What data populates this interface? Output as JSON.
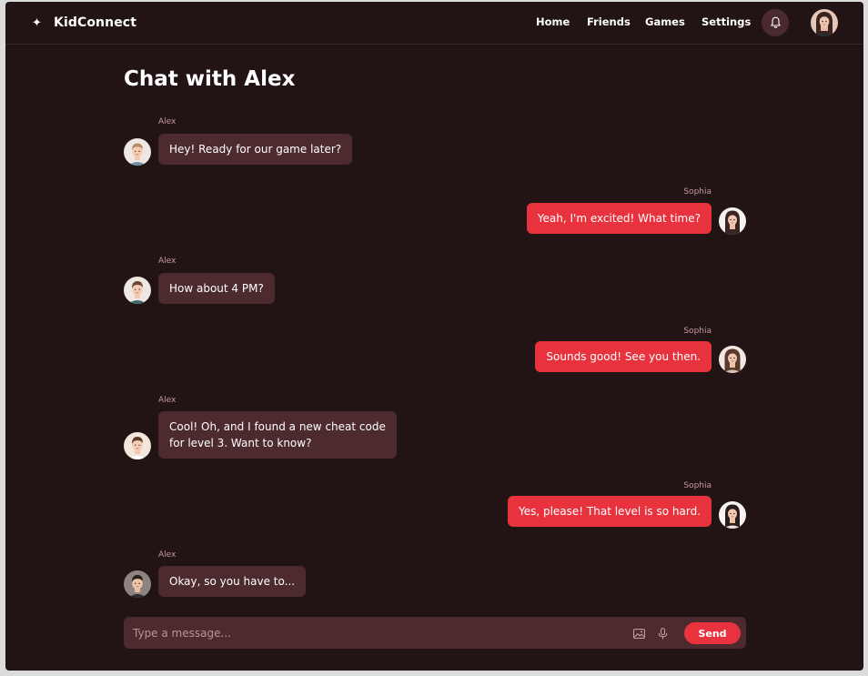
{
  "app": {
    "name": "KidConnect",
    "brand_icon": "sparkle-icon"
  },
  "nav": {
    "items": [
      "Home",
      "Friends",
      "Games",
      "Settings"
    ],
    "notification_icon": "bell-icon"
  },
  "chat": {
    "title": "Chat with Alex",
    "messages": [
      {
        "sender": "Alex",
        "direction": "incoming",
        "lines": [
          "Hey! Ready for our game later?"
        ]
      },
      {
        "sender": "Sophia",
        "direction": "outgoing",
        "lines": [
          "Yeah, I'm excited! What time?"
        ]
      },
      {
        "sender": "Alex",
        "direction": "incoming",
        "lines": [
          "How about 4 PM?"
        ]
      },
      {
        "sender": "Sophia",
        "direction": "outgoing",
        "lines": [
          "Sounds good! See you then."
        ]
      },
      {
        "sender": "Alex",
        "direction": "incoming",
        "lines": [
          "Cool! Oh, and I found a new cheat code",
          "for level 3. Want to know?"
        ]
      },
      {
        "sender": "Sophia",
        "direction": "outgoing",
        "lines": [
          "Yes, please! That level is so hard."
        ]
      },
      {
        "sender": "Alex",
        "direction": "incoming",
        "lines": [
          "Okay, so you have to..."
        ]
      }
    ]
  },
  "composer": {
    "placeholder": "Type a message...",
    "value": "",
    "image_icon": "image-icon",
    "mic_icon": "microphone-icon",
    "send_label": "Send"
  },
  "colors": {
    "background": "#221315",
    "incoming_bubble": "#4d2a2e",
    "outgoing_bubble": "#e8333e",
    "name_label": "#c79a9d",
    "accent": "#e8333e"
  }
}
